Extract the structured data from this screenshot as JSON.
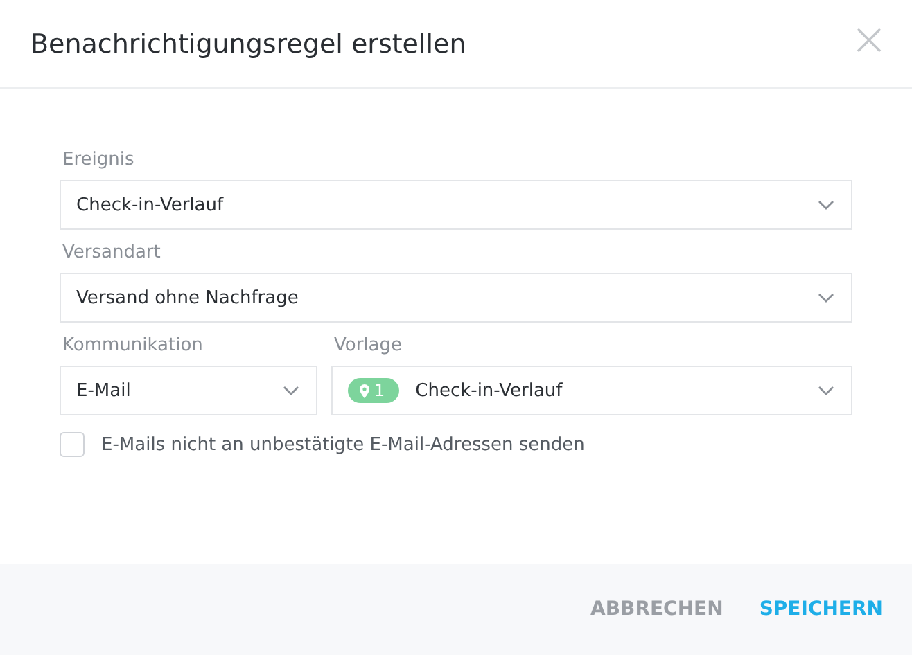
{
  "dialog": {
    "title": "Benachrichtigungsregel erstellen"
  },
  "fields": [
    {
      "label": "Ereignis",
      "value": "Check-in-Verlauf"
    },
    {
      "label": "Versandart",
      "value": "Versand ohne Nachfrage"
    }
  ],
  "row_fields": [
    {
      "label": "Kommunikation",
      "value": "E-Mail"
    },
    {
      "label": "Vorlage",
      "value": "Check-in-Verlauf",
      "badge": "1"
    }
  ],
  "checkbox": {
    "label": "E-Mails nicht an unbestätigte E-Mail-Adressen senden",
    "checked": false
  },
  "buttons": [
    {
      "label": "ABBRECHEN",
      "kind": "secondary"
    },
    {
      "label": "SPEICHERN",
      "kind": "primary"
    }
  ]
}
